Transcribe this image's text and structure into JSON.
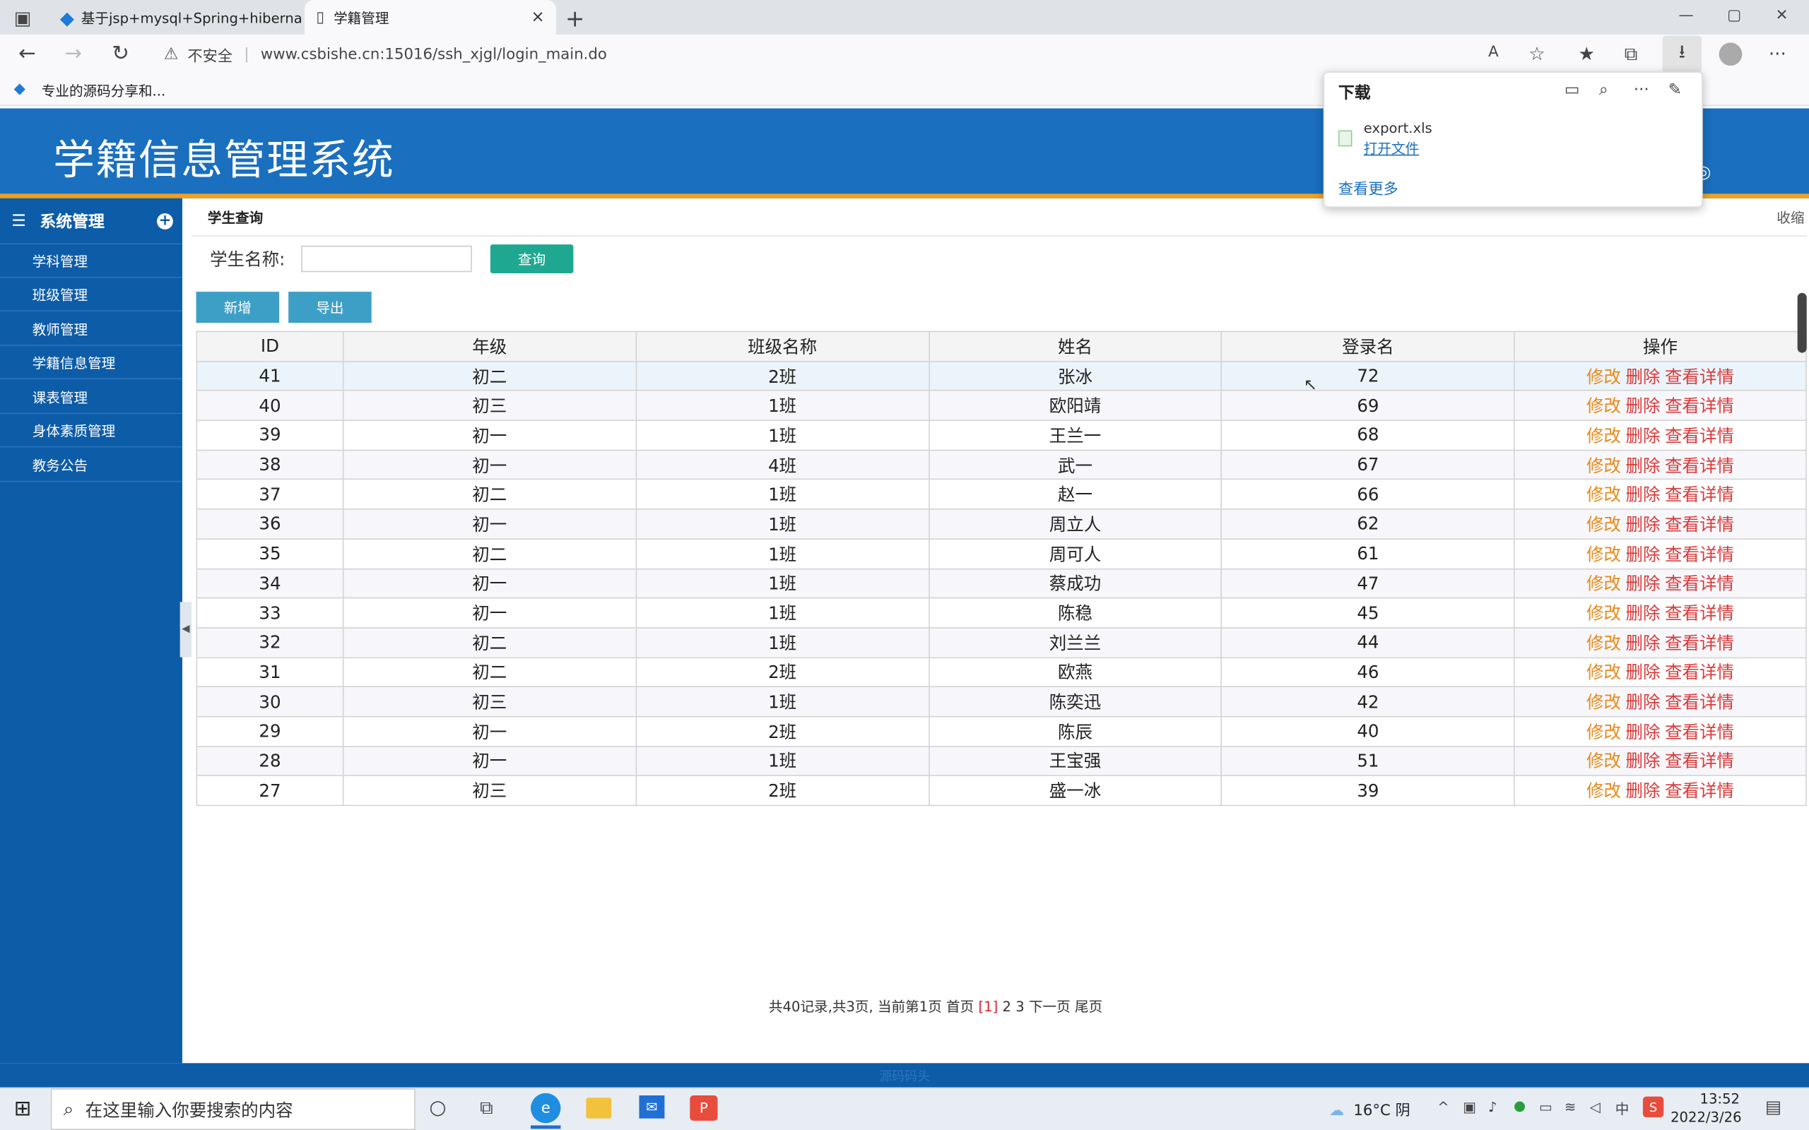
{
  "browser": {
    "tabs": [
      {
        "title": "基于jsp+mysql+Spring+hibernat",
        "close": "×"
      },
      {
        "title": "学籍管理",
        "close": "×"
      }
    ],
    "new_tab": "+",
    "security_label": "不安全",
    "url": "www.csbishe.cn:15016/ssh_xjgl/login_main.do",
    "favorite": "专业的源码分享和...",
    "window_controls": [
      "—",
      "▢",
      "✕"
    ]
  },
  "downloads": {
    "title": "下载",
    "file_name": "export.xls",
    "open_file": "打开文件",
    "see_more": "查看更多"
  },
  "app": {
    "title": "学籍信息管理系统",
    "collapse": "收缩",
    "footer": "源码码头"
  },
  "sidebar": {
    "heading": "系统管理",
    "items": [
      "学科管理",
      "班级管理",
      "教师管理",
      "学籍信息管理",
      "课表管理",
      "身体素质管理",
      "教务公告"
    ]
  },
  "main": {
    "breadcrumb": "学生查询",
    "search_label": "学生名称:",
    "search_value": "",
    "search_button": "查询",
    "add_button": "新增",
    "export_button": "导出",
    "columns": [
      "ID",
      "年级",
      "班级名称",
      "姓名",
      "登录名",
      "操作"
    ],
    "actions": {
      "edit": "修改",
      "delete": "删除",
      "view": "查看详情"
    },
    "rows": [
      [
        "41",
        "初二",
        "2班",
        "张冰",
        "72"
      ],
      [
        "40",
        "初三",
        "1班",
        "欧阳靖",
        "69"
      ],
      [
        "39",
        "初一",
        "1班",
        "王兰一",
        "68"
      ],
      [
        "38",
        "初一",
        "4班",
        "武一",
        "67"
      ],
      [
        "37",
        "初二",
        "1班",
        "赵一",
        "66"
      ],
      [
        "36",
        "初一",
        "1班",
        "周立人",
        "62"
      ],
      [
        "35",
        "初二",
        "1班",
        "周可人",
        "61"
      ],
      [
        "34",
        "初一",
        "1班",
        "蔡成功",
        "47"
      ],
      [
        "33",
        "初一",
        "1班",
        "陈稳",
        "45"
      ],
      [
        "32",
        "初二",
        "1班",
        "刘兰兰",
        "44"
      ],
      [
        "31",
        "初二",
        "2班",
        "欧燕",
        "46"
      ],
      [
        "30",
        "初三",
        "1班",
        "陈奕迅",
        "42"
      ],
      [
        "29",
        "初一",
        "2班",
        "陈辰",
        "40"
      ],
      [
        "28",
        "初一",
        "1班",
        "王宝强",
        "51"
      ],
      [
        "27",
        "初三",
        "2班",
        "盛一冰",
        "39"
      ]
    ],
    "pager": {
      "summary": "共40记录,共3页, 当前第1页",
      "first": "首页",
      "current": "[1]",
      "page2": "2",
      "page3": "3",
      "next": "下一页",
      "last": "尾页"
    }
  },
  "taskbar": {
    "search_placeholder": "在这里输入你要搜索的内容",
    "weather": "16°C 阴",
    "time": "13:52",
    "date": "2022/3/26"
  },
  "colors": {
    "header": "#1a6fbf",
    "sidebar": "#0d5ca8",
    "accent": "#f0a01e",
    "search_button": "#1fa891"
  }
}
